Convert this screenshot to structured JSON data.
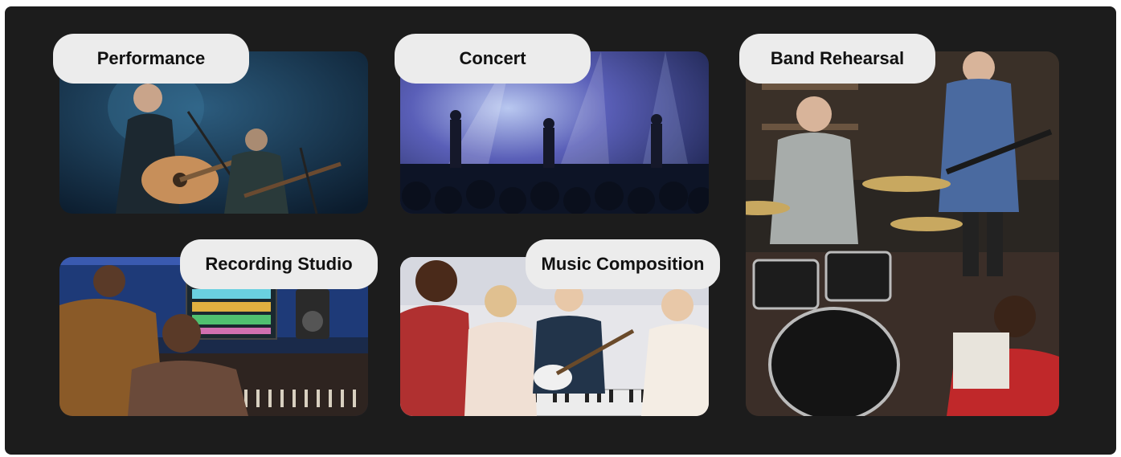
{
  "categories": [
    {
      "id": "performance",
      "label": "Performance",
      "icon": "performance-photo"
    },
    {
      "id": "concert",
      "label": "Concert",
      "icon": "concert-photo"
    },
    {
      "id": "band-rehearsal",
      "label": "Band Rehearsal",
      "icon": "band-rehearsal-photo"
    },
    {
      "id": "recording-studio",
      "label": "Recording Studio",
      "icon": "recording-studio-photo"
    },
    {
      "id": "music-composition",
      "label": "Music Composition",
      "icon": "music-composition-photo"
    }
  ],
  "colors": {
    "background": "#1c1c1c",
    "tag_background": "#ececec",
    "tag_text": "#111111"
  }
}
